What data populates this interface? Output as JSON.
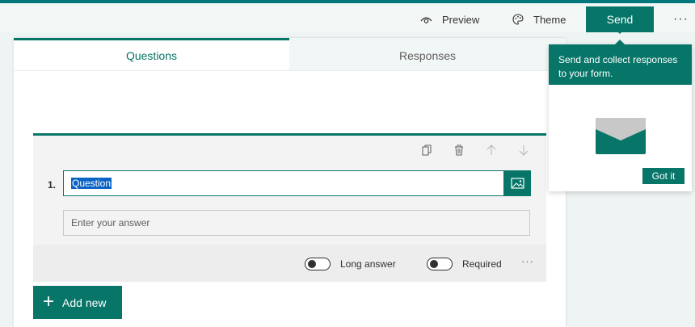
{
  "toolbar": {
    "preview_label": "Preview",
    "theme_label": "Theme",
    "send_label": "Send",
    "more_label": "···"
  },
  "tabs": [
    {
      "label": "Questions",
      "active": true
    },
    {
      "label": "Responses",
      "active": false
    }
  ],
  "question": {
    "number": "1.",
    "title_value": "Question",
    "answer_placeholder": "Enter your answer",
    "long_answer_label": "Long answer",
    "required_label": "Required",
    "more_label": "···"
  },
  "add_new_label": "Add new",
  "popover": {
    "text": "Send and collect responses to your form.",
    "got_it_label": "Got it"
  },
  "colors": {
    "accent": "#077568",
    "selection": "#0b63c4"
  },
  "icons": {
    "preview": "eye-icon",
    "theme": "palette-icon",
    "copy": "copy-icon",
    "delete": "trash-icon",
    "move_up": "arrow-up-icon",
    "move_down": "arrow-down-icon",
    "image": "image-icon",
    "add": "plus-icon",
    "envelope": "envelope-icon"
  }
}
